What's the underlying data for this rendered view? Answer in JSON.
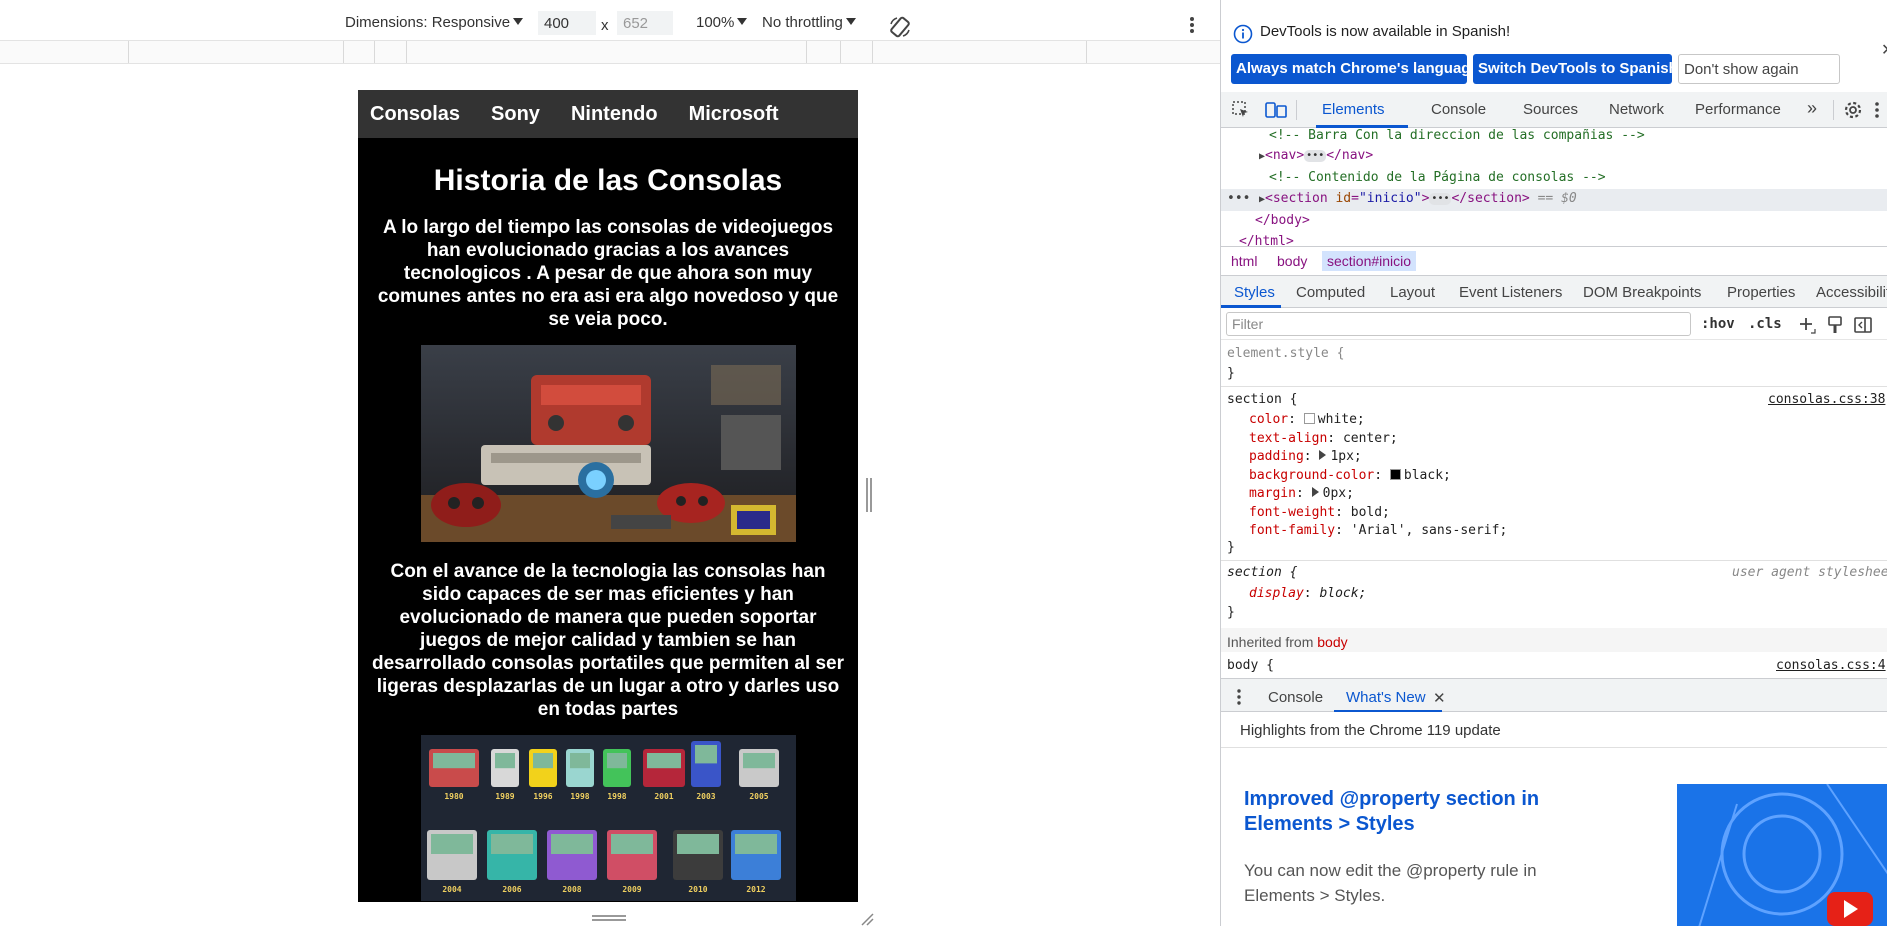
{
  "toolbar": {
    "dimensions_label": "Dimensions: Responsive",
    "width_value": "400",
    "height_value": "652",
    "times": "x",
    "zoom": "100%",
    "throttling": "No throttling"
  },
  "page": {
    "nav": [
      "Consolas",
      "Sony",
      "Nintendo",
      "Microsoft"
    ],
    "title": "Historia de las Consolas",
    "paragraph1": "A lo largo del tiempo las consolas de videojuegos han evolucionado gracias a los avances tecnologicos . A pesar de que ahora son muy comunes antes no era asi era algo novedoso y que se veia poco.",
    "paragraph2": "Con el avance de la tecnologia las consolas han sido capaces de ser mas eficientes y han evolucionado de manera que pueden soportar juegos de mejor calidad y tambien se han desarrollado consolas portatiles que permiten al ser ligeras desplazarlas de un lugar a otro y darles uso en todas partes",
    "handheld_years": [
      "1980",
      "1989",
      "1996",
      "1998",
      "1998",
      "2001",
      "2003",
      "2005",
      "2004",
      "2006",
      "2008",
      "2009",
      "2010",
      "2012"
    ]
  },
  "devtools": {
    "info_message": "DevTools is now available in Spanish!",
    "btn_match": "Always match Chrome's language",
    "btn_switch": "Switch DevTools to Spanish",
    "btn_dont_show": "Don't show again",
    "main_tabs": [
      "Elements",
      "Console",
      "Sources",
      "Network",
      "Performance"
    ],
    "dom": {
      "comment1": "<!-- Barra Con la direccion de las compañias -->",
      "nav_open": "<nav>",
      "nav_close": "</nav>",
      "comment2": "<!-- Contenido de la Página de consolas -->",
      "section_open_tag": "<section",
      "section_attr_name": "id",
      "section_attr_value": "\"inicio\"",
      "section_close": "</section>",
      "section_marker": "== $0",
      "body_close": "</body>",
      "html_close": "</html>"
    },
    "breadcrumbs": [
      "html",
      "body",
      "section#inicio"
    ],
    "style_tabs": [
      "Styles",
      "Computed",
      "Layout",
      "Event Listeners",
      "DOM Breakpoints",
      "Properties",
      "Accessibility"
    ],
    "filter_placeholder": "Filter",
    "hov": ":hov",
    "cls": ".cls",
    "styles": {
      "element_style": "element.style {",
      "rule1_selector": "section {",
      "rule1_source": "consolas.css:38",
      "rule1_props": [
        {
          "name": "color",
          "value": "white;",
          "swatch": "#ffffff"
        },
        {
          "name": "text-align",
          "value": "center;"
        },
        {
          "name": "padding",
          "value": "1px;",
          "expand": true
        },
        {
          "name": "background-color",
          "value": "black;",
          "swatch": "#000000"
        },
        {
          "name": "margin",
          "value": "0px;",
          "expand": true
        },
        {
          "name": "font-weight",
          "value": "bold;"
        },
        {
          "name": "font-family",
          "value": "'Arial', sans-serif;"
        }
      ],
      "rule2_selector": "section {",
      "rule2_source": "user agent stylesheet",
      "rule2_prop_name": "display",
      "rule2_prop_value": "block;",
      "inherited_label": "Inherited from",
      "inherited_tag": "body",
      "body_selector": "body {",
      "body_source": "consolas.css:4",
      "close_brace": "}"
    },
    "drawer_tabs": [
      "Console",
      "What's New"
    ],
    "highlights": "Highlights from the Chrome 119 update",
    "whats_new_title": "Improved @property section in Elements > Styles",
    "whats_new_desc": "You can now edit the @property rule in Elements > Styles.",
    "colors": {
      "accent": "#0b57d0",
      "tag": "#881280",
      "comment": "#236e25",
      "prop": "#c80000"
    }
  }
}
